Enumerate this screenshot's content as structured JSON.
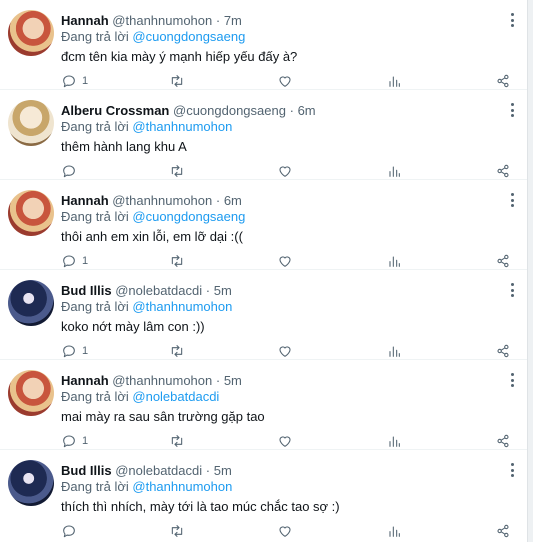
{
  "tweets": [
    {
      "name": "Hannah",
      "handle": "@thanhnumohon",
      "separator": "·",
      "time": "7m",
      "reply_prefix": "Đang trả lời ",
      "reply_to": "@cuongdongsaeng",
      "text": "đcm tên kia mày ý mạnh hiếp yếu đấy à?",
      "reply_count": "1",
      "avatar_style": "warm"
    },
    {
      "name": "Alberu Crossman",
      "handle": "@cuongdongsaeng",
      "separator": "·",
      "time": "6m",
      "reply_prefix": "Đang trả lời ",
      "reply_to": "@thanhnumohon",
      "text": "thêm hành lang khu A",
      "reply_count": "",
      "avatar_style": "pale"
    },
    {
      "name": "Hannah",
      "handle": "@thanhnumohon",
      "separator": "·",
      "time": "6m",
      "reply_prefix": "Đang trả lời ",
      "reply_to": "@cuongdongsaeng",
      "text": "thôi anh em xin lỗi, em lỡ dại :((",
      "reply_count": "1",
      "avatar_style": "warm"
    },
    {
      "name": "Bud Illis",
      "handle": "@nolebatdacdi",
      "separator": "·",
      "time": "5m",
      "reply_prefix": "Đang trả lời ",
      "reply_to": "@thanhnumohon",
      "text": "koko nớt mày lâm con :))",
      "reply_count": "1",
      "avatar_style": "dark"
    },
    {
      "name": "Hannah",
      "handle": "@thanhnumohon",
      "separator": "·",
      "time": "5m",
      "reply_prefix": "Đang trả lời ",
      "reply_to": "@nolebatdacdi",
      "text": "mai mày ra sau sân trường gặp tao",
      "reply_count": "1",
      "avatar_style": "warm"
    },
    {
      "name": "Bud Illis",
      "handle": "@nolebatdacdi",
      "separator": "·",
      "time": "5m",
      "reply_prefix": "Đang trả lời ",
      "reply_to": "@thanhnumohon",
      "text": "thích thì nhích, mày tới là tao múc chắc tao sợ :)",
      "reply_count": "",
      "avatar_style": "dark"
    }
  ],
  "icons": {
    "reply": "reply-icon",
    "retweet": "retweet-icon",
    "like": "heart-icon",
    "analytics": "analytics-icon",
    "share": "share-icon",
    "more": "more-options-icon"
  },
  "colors": {
    "mention": "#1d9bf0",
    "secondary_text": "#536471",
    "primary_text": "#0f1419"
  }
}
